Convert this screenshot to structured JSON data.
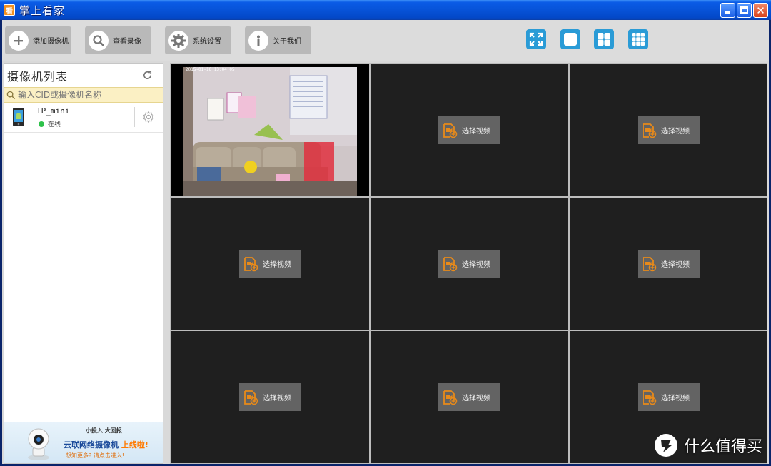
{
  "window": {
    "title": "掌上看家",
    "app_icon": "看"
  },
  "toolbar": {
    "buttons": [
      {
        "label": "添加摄像机",
        "icon": "plus-icon"
      },
      {
        "label": "查看录像",
        "icon": "magnifier-icon"
      },
      {
        "label": "系统设置",
        "icon": "gear-icon"
      },
      {
        "label": "关于我们",
        "icon": "info-icon"
      }
    ],
    "layouts": [
      "fullscreen-icon",
      "single-view-icon",
      "quad-view-icon",
      "nine-view-icon"
    ]
  },
  "sidebar": {
    "title": "摄像机列表",
    "search_placeholder": "输入CID或摄像机名称",
    "cameras": [
      {
        "name": "TP_mini",
        "status": "在线",
        "status_color": "#2ec24a"
      }
    ],
    "ad": {
      "sub": "小投入  大回报",
      "main_prefix": "云联网络摄像机",
      "main_highlight": "上线啦!",
      "foot": "想知更多? 请点击进入!"
    }
  },
  "grid": {
    "live": {
      "timestamp": "2015-01-16 13:04:05"
    },
    "empty_label": "选择视频",
    "cells": 9
  },
  "watermark": {
    "text": "什么值得买"
  },
  "colors": {
    "accent": "#2a9bd6",
    "select_icon": "#e88a1a",
    "online": "#2ec24a"
  }
}
